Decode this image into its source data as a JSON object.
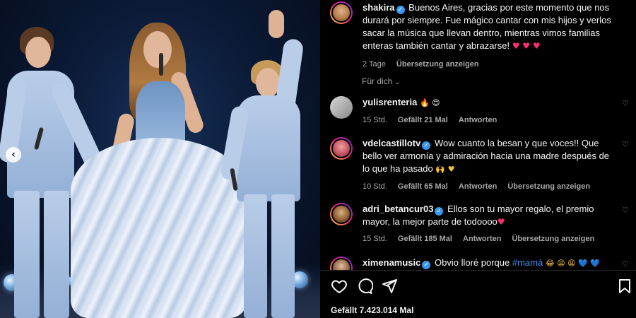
{
  "post": {
    "username": "shakira",
    "caption": "Buenos Aires, gracias por este momento que nos durará por siempre. Fue mágico cantar con mis hijos y verlos sacar la música que llevan dentro, mientras vimos familias enteras también cantar y abrazarse!",
    "caption_emoji": "♥ ♥ ♥",
    "time": "2 Tage",
    "translate": "Übersetzung anzeigen"
  },
  "sort_label": "Für dich",
  "comments": [
    {
      "username": "yulisrenteria",
      "verified": false,
      "text": "",
      "emoji": "🔥 😍",
      "time": "15 Std.",
      "likes": "Gefällt 21 Mal",
      "reply": "Antworten",
      "translate": ""
    },
    {
      "username": "vdelcastillotv",
      "verified": true,
      "text": "Wow cuanto la besan y que voces!! Que bello ver armonía y admiración hacia una madre después de lo que ha pasado",
      "emoji": "🙌 ♥",
      "time": "10 Std.",
      "likes": "Gefällt 65 Mal",
      "reply": "Antworten",
      "translate": "Übersetzung anzeigen"
    },
    {
      "username": "adri_betancur03",
      "verified": true,
      "text": "Ellos son tu mayor regalo, el premio mayor, la mejor parte de todoooo",
      "emoji": "♥",
      "time": "15 Std.",
      "likes": "Gefällt 185 Mal",
      "reply": "Antworten",
      "translate": "Übersetzung anzeigen"
    },
    {
      "username": "ximenamusic",
      "verified": true,
      "text": "Obvio lloré porque",
      "hashtag": "#mamá",
      "emoji": "😂 😩 😩 💙 💙",
      "time": "",
      "likes": "",
      "reply": "",
      "translate": ""
    }
  ],
  "like_count": "Gefällt 7.423.014 Mal",
  "icons": {
    "like": "heart-outline-icon",
    "comment": "comment-bubble-icon",
    "share": "paper-plane-icon",
    "save": "bookmark-icon",
    "prev": "chevron-left-icon"
  },
  "colors": {
    "background": "#000000",
    "text": "#f5f5f5",
    "muted": "#a8a8a8",
    "verified": "#3897f0",
    "hashtag": "#4a8ef0"
  }
}
